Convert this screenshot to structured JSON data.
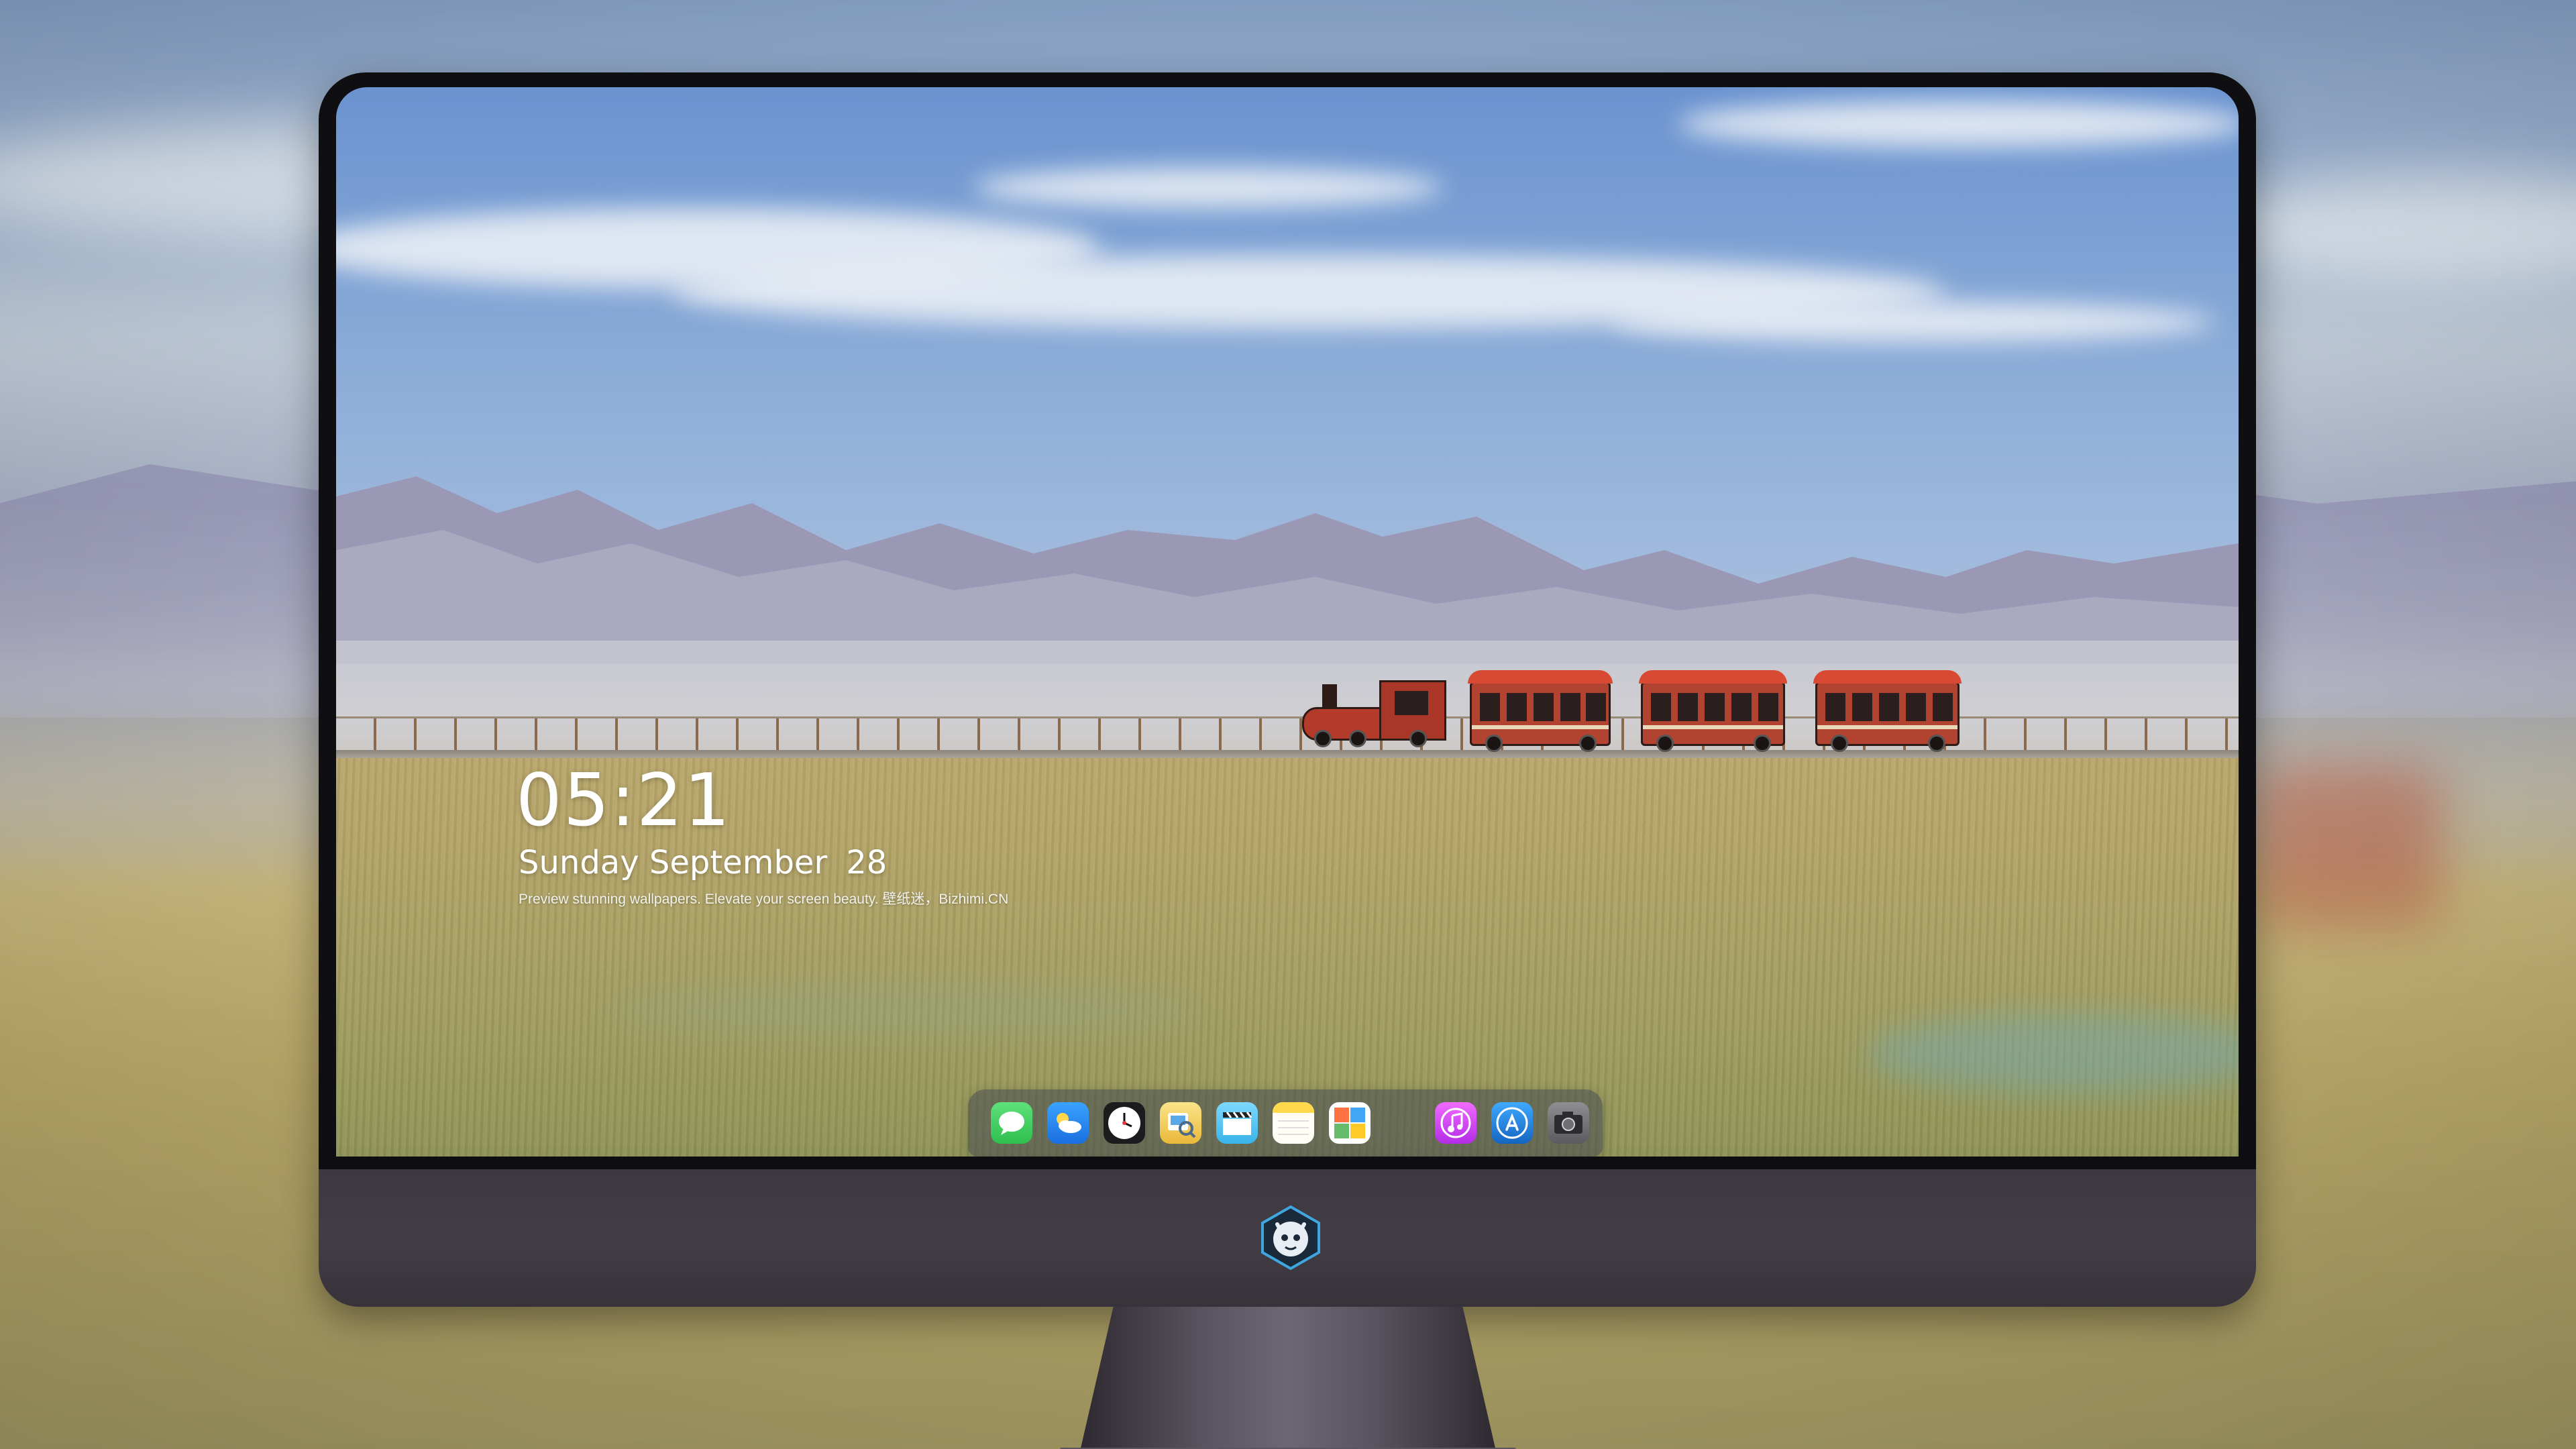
{
  "lockscreen": {
    "time": "05:21",
    "weekday": "Sunday",
    "month": "September",
    "day": "28",
    "tagline": "Preview stunning wallpapers. Elevate your screen beauty. 壁纸迷，Bizhimi.CN"
  },
  "dock": {
    "apps": [
      {
        "name": "Messages",
        "icon": "messages-icon",
        "color": "#34c759"
      },
      {
        "name": "Weather",
        "icon": "weather-icon",
        "color": "#2e8cf0"
      },
      {
        "name": "Clock",
        "icon": "clock-icon",
        "color": "#1c1c1e"
      },
      {
        "name": "Preview",
        "icon": "preview-icon",
        "color": "#f2c94c"
      },
      {
        "name": "Clips",
        "icon": "clapperboard-icon",
        "color": "#4fc3f7"
      },
      {
        "name": "Notes",
        "icon": "notes-icon",
        "color": "#ffd84d"
      },
      {
        "name": "Photo Booth",
        "icon": "photo-booth-icon",
        "color": "#8bc34a"
      },
      {
        "name": "iTunes",
        "icon": "music-icon",
        "color": "#e040fb"
      },
      {
        "name": "App Store",
        "icon": "app-store-icon",
        "color": "#1e88e5"
      },
      {
        "name": "Camera",
        "icon": "camera-icon",
        "color": "#6e6e73"
      }
    ]
  },
  "monitor": {
    "logo": "dragon-mascot-logo",
    "bezel_color": "#0f0f12",
    "chin_color": "#3d383f"
  }
}
